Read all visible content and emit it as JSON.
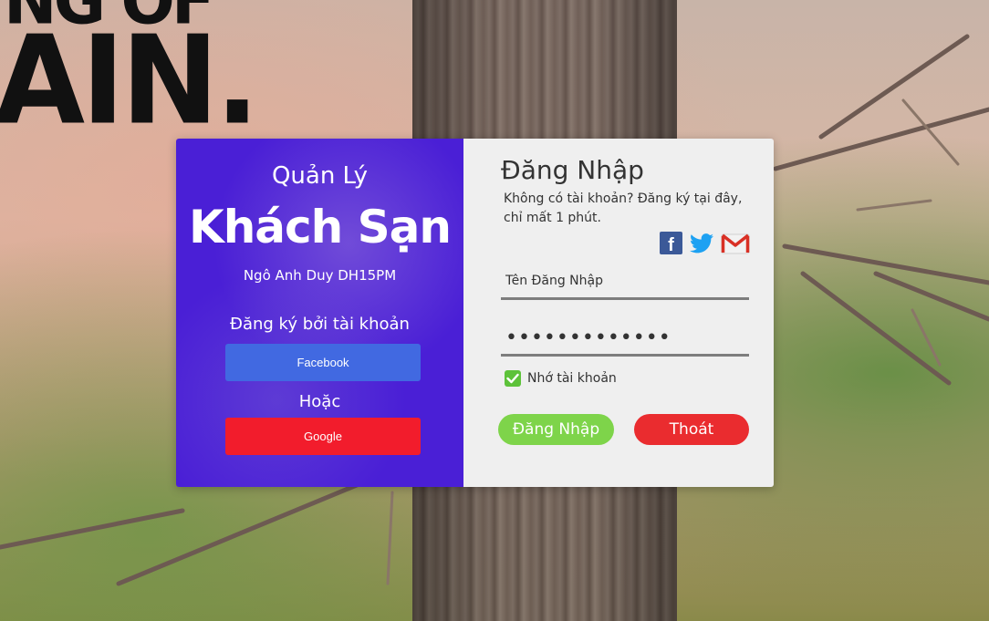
{
  "background": {
    "graffiti_line1": "NG OF",
    "graffiti_line2": "AIN."
  },
  "left_panel": {
    "subtitle": "Quản Lý",
    "title": "Khách Sạn",
    "author": "Ngô Anh Duy DH15PM",
    "register_by": "Đăng ký bởi tài khoản",
    "facebook_label": "Facebook",
    "or_label": "Hoặc",
    "google_label": "Google",
    "colors": {
      "panel": "#4a1fd6",
      "facebook": "#4169e1",
      "google": "#f21c2c"
    }
  },
  "login_form": {
    "title": "Đăng Nhập",
    "description": "Không có tài khoản? Đăng ký tại đây, chỉ mất 1 phút.",
    "social_icons": [
      "facebook-icon",
      "twitter-icon",
      "gmail-icon"
    ],
    "username_placeholder": "Tên Đăng Nhập",
    "password_value": "•••••••••••••",
    "remember_label": "Nhớ tài khoản",
    "remember_checked": true,
    "login_label": "Đăng Nhập",
    "exit_label": "Thoát",
    "colors": {
      "login": "#7ed44a",
      "exit": "#ea2c2f",
      "check": "#5dc23a"
    }
  }
}
